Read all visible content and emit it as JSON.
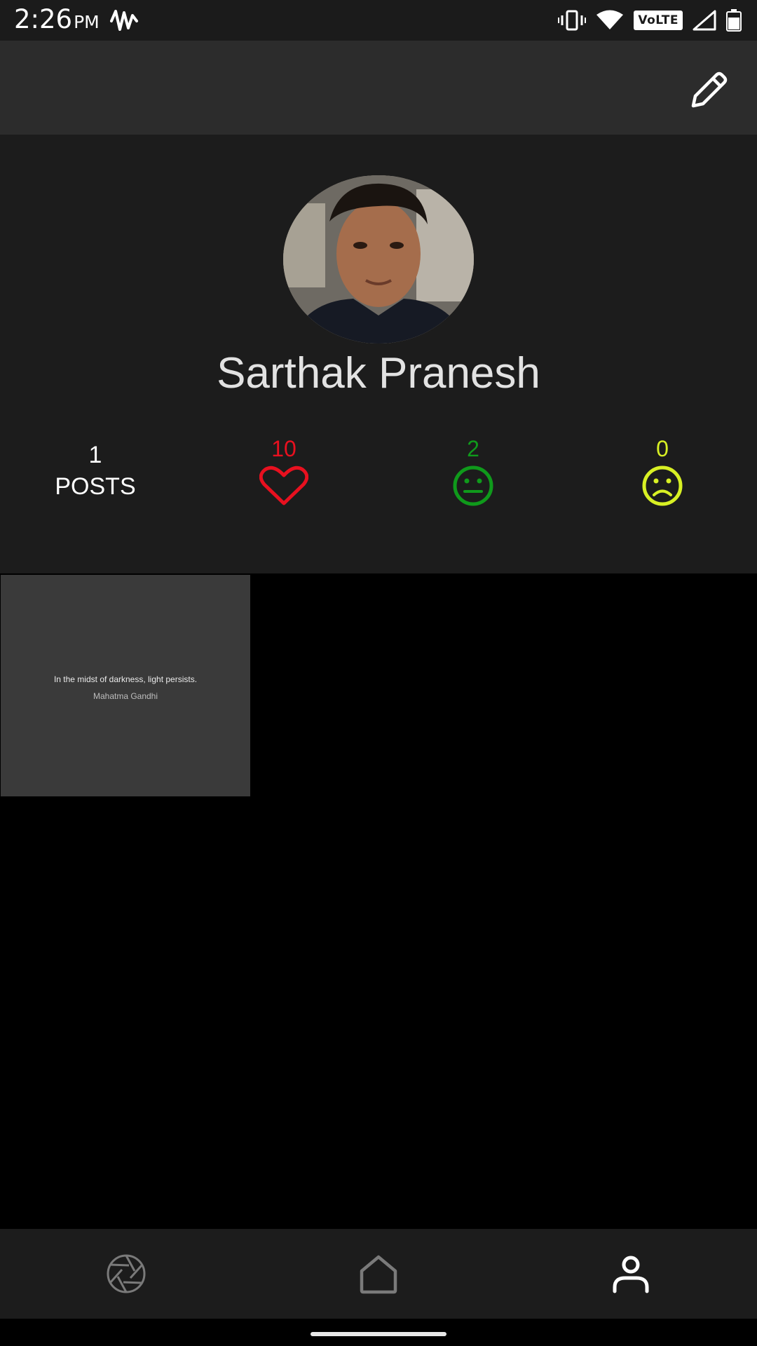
{
  "status_bar": {
    "time": "2:26",
    "ampm": "PM",
    "network_badge": "VoLTE"
  },
  "profile": {
    "name": "Sarthak Pranesh",
    "posts_count": "1",
    "posts_label": "POSTS",
    "reactions": {
      "love": {
        "count": "10",
        "color": "#e8101f",
        "icon": "heart-icon"
      },
      "neutral": {
        "count": "2",
        "color": "#0f9a1b",
        "icon": "neutral-face-icon"
      },
      "sad": {
        "count": "0",
        "color": "#d8f024",
        "icon": "sad-face-icon"
      }
    }
  },
  "posts": [
    {
      "quote": "In the midst of darkness, light persists.",
      "author": "Mahatma Gandhi"
    }
  ],
  "bottom_nav": {
    "items": [
      {
        "icon": "camera-aperture-icon",
        "active": false
      },
      {
        "icon": "home-icon",
        "active": false
      },
      {
        "icon": "profile-icon",
        "active": true
      }
    ]
  }
}
